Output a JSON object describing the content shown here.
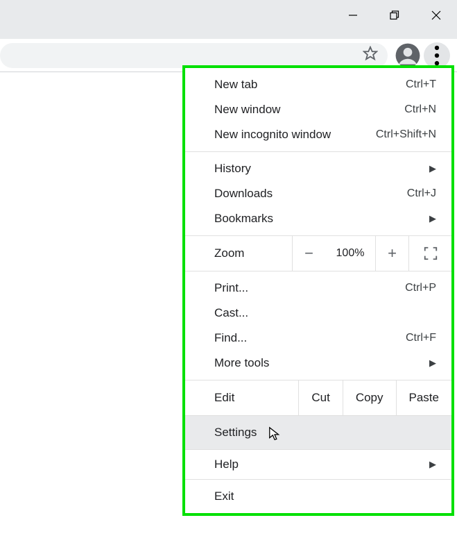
{
  "window": {
    "minimize": "Minimize",
    "maximize": "Maximize",
    "close": "Close"
  },
  "toolbar": {
    "bookmark_star": "Bookmark this page",
    "account": "Account",
    "menu": "Customize and control"
  },
  "menu": {
    "new_tab": {
      "label": "New tab",
      "shortcut": "Ctrl+T"
    },
    "new_window": {
      "label": "New window",
      "shortcut": "Ctrl+N"
    },
    "new_incognito": {
      "label": "New incognito window",
      "shortcut": "Ctrl+Shift+N"
    },
    "history": {
      "label": "History"
    },
    "downloads": {
      "label": "Downloads",
      "shortcut": "Ctrl+J"
    },
    "bookmarks": {
      "label": "Bookmarks"
    },
    "zoom": {
      "label": "Zoom",
      "minus": "−",
      "value": "100%",
      "plus": "+"
    },
    "print": {
      "label": "Print...",
      "shortcut": "Ctrl+P"
    },
    "cast": {
      "label": "Cast..."
    },
    "find": {
      "label": "Find...",
      "shortcut": "Ctrl+F"
    },
    "more_tools": {
      "label": "More tools"
    },
    "edit": {
      "label": "Edit",
      "cut": "Cut",
      "copy": "Copy",
      "paste": "Paste"
    },
    "settings": {
      "label": "Settings"
    },
    "help": {
      "label": "Help"
    },
    "exit": {
      "label": "Exit"
    }
  }
}
